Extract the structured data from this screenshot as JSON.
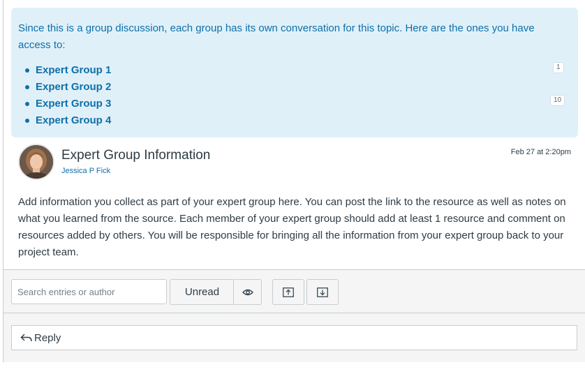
{
  "banner": {
    "text": "Since this is a group discussion, each group has its own conversation for this topic. Here are the ones you have access to:",
    "groups": [
      "Expert Group 1",
      "Expert Group 2",
      "Expert Group 3",
      "Expert Group 4"
    ],
    "badges": [
      "1",
      "10"
    ]
  },
  "post": {
    "title": "Expert Group Information",
    "author": "Jessica P Fick",
    "date": "Feb 27 at 2:20pm",
    "body": "Add information you collect as part of your expert group here. You can post the link to the resource as well as notes on what you learned from the source. Each member of your expert group should add at least 1 resource and comment on resources added by others. You will be responsible for bringing all the information from your expert group back to your project team."
  },
  "toolbar": {
    "search_placeholder": "Search entries or author",
    "unread_label": "Unread",
    "icons": [
      "eye-icon",
      "expand-up-icon",
      "collapse-down-icon"
    ]
  },
  "reply": {
    "label": "Reply",
    "icon": "reply-arrow-icon"
  },
  "colors": {
    "link": "#0e70a8",
    "banner_bg": "#e0f0f9",
    "text": "#2d3b45",
    "toolbar_bg": "#f5f5f5"
  }
}
